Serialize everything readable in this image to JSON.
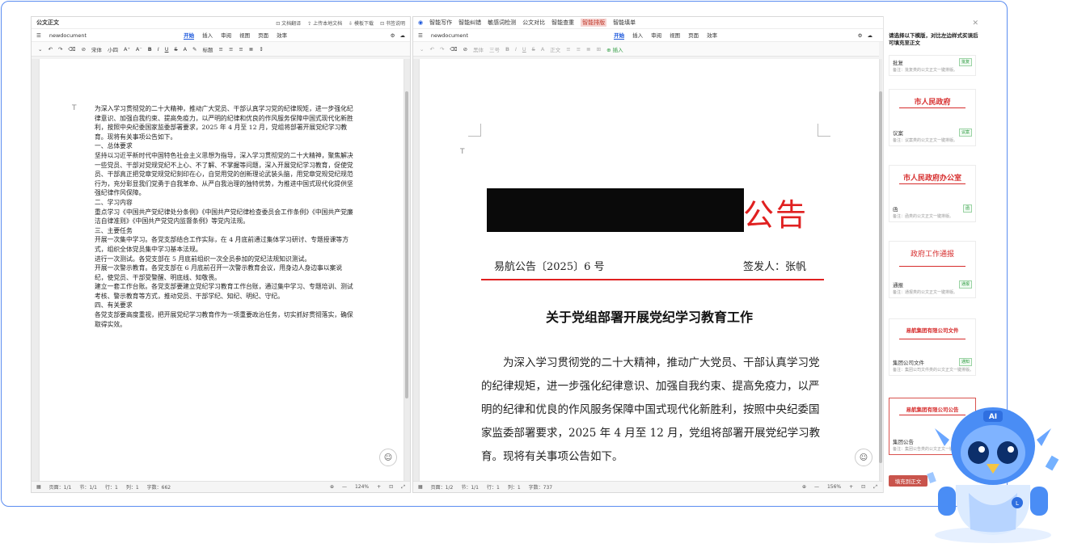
{
  "left_window": {
    "title": "公文正文",
    "title_actions": [
      "⊡ 文档翻译",
      "⇪ 上传本地文档",
      "⇩ 模板下载",
      "⊡ 书签说明"
    ],
    "doc_name": "newdocument",
    "tabs": [
      "开始",
      "插入",
      "审阅",
      "视图",
      "页面",
      "效率"
    ],
    "active_tab": "开始",
    "toolbar": {
      "font": "宋体",
      "size": "小四",
      "style": "标题"
    },
    "doc_paragraphs": [
      "为深入学习贯彻党的二十大精神，推动广大党员、干部认真学习党的纪律规矩，进一步强化纪律意识、加强自我约束、提高免疫力，以严明的纪律和优良的作风服务保障中国式现代化新胜利，按照中央纪委国家监委部署要求，2025 年 4 月至 12 月，党组将部署开展党纪学习教育。现将有关事项公告如下。",
      "一、总体要求",
      "坚持以习近平新时代中国特色社会主义思想为指导，深入学习贯彻党的二十大精神，聚焦解决一些党员、干部对党规党纪不上心、不了解、不掌握等问题，深入开展党纪学习教育，促使党员、干部真正把党章党规党纪刻印在心，自觉用党的创新理论武装头脑，用党章党规党纪规范行为，充分彰显我们党勇于自我革命、从严自我治理的独特优势，为推进中国式现代化提供坚强纪律作风保障。",
      "二、学习内容",
      "重点学习《中国共产党纪律处分条例》《中国共产党纪律检查委员会工作条例》《中国共产党廉洁自律准则》《中国共产党党内监督条例》等党内法规。",
      "三、主要任务",
      "开展一次集中学习。各党支部结合工作实际，在 4 月底前通过集体学习研讨、专题授课等方式，组织全体党员集中学习基本法规。",
      "进行一次测试。各党支部在 5 月底前组织一次全员参加的党纪法规知识测试。",
      "开展一次警示教育。各党支部在 6 月底前召开一次警示教育会议，用身边人身边事以案说纪，使党员、干部受警醒、明底线、知敬畏。",
      "建立一套工作台账。各党支部要建立党纪学习教育工作台账，通过集中学习、专题培训、测试考核、警示教育等方式，推动党员、干部学纪、知纪、明纪、守纪。",
      "四、有关要求",
      "各党支部要高度重视，把开展党纪学习教育作为一项重要政治任务，切实抓好贯彻落实，确保取得实效。"
    ],
    "status": {
      "page": "页面：1/1",
      "section": "节：1/1",
      "row": "行：1",
      "col": "列：1",
      "words": "字数：662",
      "zoom": "124%"
    }
  },
  "right_window": {
    "ai_tabs": [
      "智能写作",
      "智能纠错",
      "敏感词检测",
      "公文对比",
      "智能查重",
      "智能排版",
      "智能填单"
    ],
    "active_ai_tab": "智能排版",
    "doc_name": "newdocument",
    "tabs": [
      "开始",
      "插入",
      "审阅",
      "视图",
      "页面",
      "效率"
    ],
    "active_tab": "开始",
    "toolbar": {
      "font": "黑体",
      "size": "三号",
      "style": "正文",
      "insert": "插入"
    },
    "doc": {
      "header_char": "公告",
      "doc_number": "易航公告〔2025〕6 号",
      "signer": "签发人：张帆",
      "title": "关于党组部署开展党纪学习教育工作",
      "body": "为深入学习贯彻党的二十大精神，推动广大党员、干部认真学习党的纪律规矩，进一步强化纪律意识、加强自我约束、提高免疫力，以严明的纪律和优良的作风服务保障中国式现代化新胜利，按照中央纪委国家监委部署要求，2025 年 4 月至 12 月，党组将部署开展党纪学习教育。现将有关事项公告如下。"
    },
    "status": {
      "page": "页面：1/2",
      "section": "节：1/1",
      "row": "行：1",
      "col": "列：1",
      "words": "字数：737",
      "zoom": "156%"
    }
  },
  "template_panel": {
    "hint": "请选择以下模版，对比左边样式买误后可填充至正文",
    "templates": [
      {
        "header": "",
        "name": "批复",
        "tag": "批复",
        "desc": "备注：批复类的公文正文一键排版。"
      },
      {
        "header": "市人民政府",
        "name": "议案",
        "tag": "议案",
        "desc": "备注：议案类的公文正文一键排版。"
      },
      {
        "header": "市人民政府办公室",
        "name": "函",
        "tag": "函",
        "desc": "备注：函类的公文正文一键排版。"
      },
      {
        "header": "政府工作通报",
        "name": "通报",
        "tag": "通报",
        "desc": "备注：通报类的公文正文一键排版。"
      },
      {
        "header": "易航集团有限公司文件",
        "name": "集团公司文件",
        "tag": "通知",
        "desc": "备注：集团公司文件类的公文正文一键排版。"
      },
      {
        "header": "易航集团有限公司公告",
        "name": "集团公告",
        "tag": "",
        "desc": "备注：集团公告类的公文正文一键排版。"
      }
    ],
    "fill_button": "填充到正文"
  },
  "mascot": {
    "badge": "AI"
  }
}
